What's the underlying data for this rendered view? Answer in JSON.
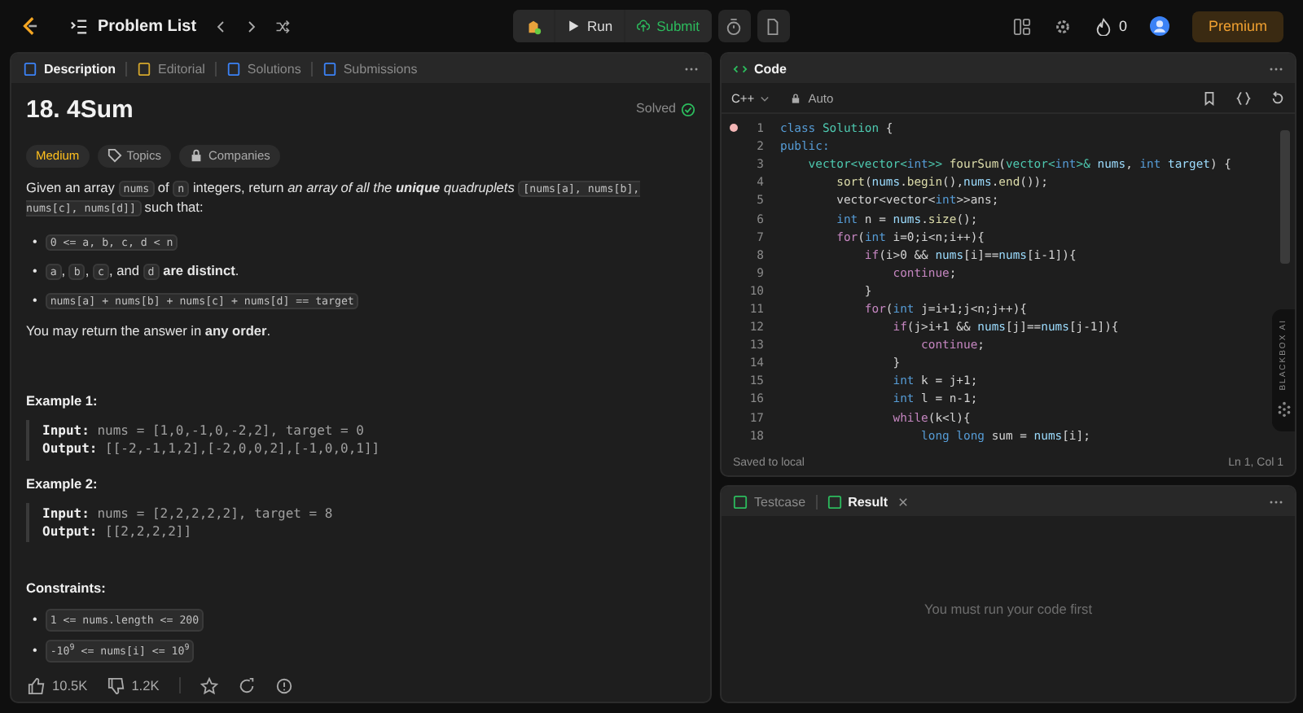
{
  "topbar": {
    "title": "Problem List",
    "run": "Run",
    "submit": "Submit",
    "streak": "0",
    "premium": "Premium"
  },
  "left_tabs": [
    {
      "label": "Description",
      "selected": true
    },
    {
      "label": "Editorial",
      "selected": false
    },
    {
      "label": "Solutions",
      "selected": false
    },
    {
      "label": "Submissions",
      "selected": false
    }
  ],
  "problem": {
    "title": "18. 4Sum",
    "status": "Solved",
    "difficulty": "Medium",
    "tags": [
      "Topics",
      "Companies"
    ],
    "statement": [
      {
        "kind": "text",
        "text": "Given an array "
      },
      {
        "kind": "code",
        "text": "nums"
      },
      {
        "kind": "text",
        "text": " of "
      },
      {
        "kind": "code",
        "text": "n"
      },
      {
        "kind": "text",
        "text": " integers, return "
      },
      {
        "kind": "italic",
        "text": "an array of all the "
      },
      {
        "kind": "bold_italic",
        "text": "unique"
      },
      {
        "kind": "italic",
        "text": " quadruplets "
      },
      {
        "kind": "code",
        "text": "[nums[a], nums[b], nums[c], nums[d]]"
      },
      {
        "kind": "text",
        "text": " such that:"
      }
    ],
    "conditions": [
      {
        "bullet": "•",
        "parts": [
          {
            "kind": "code",
            "text": "0 <= a, b, c, d < n"
          }
        ]
      },
      {
        "bullet": "•",
        "parts": [
          {
            "kind": "code",
            "text": "a"
          },
          {
            "kind": "text",
            "text": ", "
          },
          {
            "kind": "code",
            "text": "b"
          },
          {
            "kind": "text",
            "text": ", "
          },
          {
            "kind": "code",
            "text": "c"
          },
          {
            "kind": "text",
            "text": ", and "
          },
          {
            "kind": "code",
            "text": "d"
          },
          {
            "kind": "text",
            "text": " **are distinct**."
          }
        ]
      },
      {
        "bullet": "•",
        "parts": [
          {
            "kind": "code",
            "text": "nums[a] + nums[b] + nums[c] + nums[d] == target"
          }
        ]
      }
    ],
    "note": "You may return the answer in **any order**.",
    "examples": [
      {
        "title": "Example 1:",
        "input_label": "Input:",
        "input": "nums = [1,0,-1,0,-2,2], target = 0",
        "output_label": "Output:",
        "output": "[[-2,-1,1,2],[-2,0,0,2],[-1,0,0,1]]"
      },
      {
        "title": "Example 2:",
        "input_label": "Input:",
        "input": "nums = [2,2,2,2,2], target = 8",
        "output_label": "Output:",
        "output": "[[2,2,2,2]]"
      }
    ],
    "constraints_title": "Constraints:",
    "constraints": [
      {
        "bullet": "•",
        "text": "1 <= nums.length <= 200"
      },
      {
        "bullet": "•",
        "text": "-10$^{9}$ <= nums[i] <= 10$^{9}$"
      }
    ],
    "likes": "10.5K",
    "dislikes": "1.2K"
  },
  "code_panel": {
    "tab": "Code",
    "language": "C++",
    "mode": "Auto",
    "status": "Saved to local",
    "cursor": "Ln 1, Col 1",
    "assistant": "BLACKBOX AI",
    "lines": [
      {
        "num": "1",
        "breakpoint": true,
        "tokens": [
          {
            "kind": "kw",
            "text": "class"
          },
          {
            "kind": "ty",
            "text": " Solution"
          },
          {
            "kind": "p",
            "text": " {"
          }
        ]
      },
      {
        "num": "2",
        "breakpoint": false,
        "tokens": [
          {
            "kind": "kw",
            "text": "public:"
          }
        ]
      },
      {
        "num": "3",
        "breakpoint": false,
        "tokens": [
          {
            "kind": "ty",
            "text": "    vector<vector<"
          },
          {
            "kind": "kw",
            "text": "int"
          },
          {
            "kind": "ty",
            "text": ">> "
          },
          {
            "kind": "fn",
            "text": "fourSum"
          },
          {
            "kind": "p",
            "text": "("
          },
          {
            "kind": "ty",
            "text": "vector<"
          },
          {
            "kind": "kw",
            "text": "int"
          },
          {
            "kind": "ty",
            "text": ">&"
          },
          {
            "kind": "v",
            "text": " nums"
          },
          {
            "kind": "p",
            "text": ", "
          },
          {
            "kind": "kw",
            "text": "int"
          },
          {
            "kind": "v",
            "text": " target"
          },
          {
            "kind": "p",
            "text": ") {"
          }
        ]
      },
      {
        "num": "4",
        "breakpoint": false,
        "tokens": [
          {
            "kind": "fn",
            "text": "        sort"
          },
          {
            "kind": "p",
            "text": "("
          },
          {
            "kind": "v",
            "text": "nums"
          },
          {
            "kind": "p",
            "text": "."
          },
          {
            "kind": "fn",
            "text": "begin"
          },
          {
            "kind": "p",
            "text": "(),"
          },
          {
            "kind": "v",
            "text": "nums"
          },
          {
            "kind": "p",
            "text": "."
          },
          {
            "kind": "fn",
            "text": "end"
          },
          {
            "kind": "p",
            "text": "());"
          }
        ]
      },
      {
        "num": "5",
        "breakpoint": false,
        "tokens": [
          {
            "kind": "p",
            "text": "        vector<vector<"
          },
          {
            "kind": "kw",
            "text": "int"
          },
          {
            "kind": "p",
            "text": ">>ans;"
          }
        ]
      },
      {
        "num": "6",
        "breakpoint": false,
        "tokens": [
          {
            "kind": "kw",
            "text": "        int"
          },
          {
            "kind": "p",
            "text": " n = "
          },
          {
            "kind": "v",
            "text": "nums"
          },
          {
            "kind": "p",
            "text": "."
          },
          {
            "kind": "fn",
            "text": "size"
          },
          {
            "kind": "p",
            "text": "();"
          }
        ]
      },
      {
        "num": "7",
        "breakpoint": false,
        "tokens": [
          {
            "kind": "ctl",
            "text": "        for"
          },
          {
            "kind": "p",
            "text": "("
          },
          {
            "kind": "kw",
            "text": "int"
          },
          {
            "kind": "p",
            "text": " i=0;i<n;i++){"
          }
        ]
      },
      {
        "num": "8",
        "breakpoint": false,
        "tokens": [
          {
            "kind": "ctl",
            "text": "            if"
          },
          {
            "kind": "p",
            "text": "(i>0 && "
          },
          {
            "kind": "v",
            "text": "nums"
          },
          {
            "kind": "p",
            "text": "[i]=="
          },
          {
            "kind": "v",
            "text": "nums"
          },
          {
            "kind": "p",
            "text": "[i-1]){"
          }
        ]
      },
      {
        "num": "9",
        "breakpoint": false,
        "tokens": [
          {
            "kind": "ctl",
            "text": "                continue"
          },
          {
            "kind": "p",
            "text": ";"
          }
        ]
      },
      {
        "num": "10",
        "breakpoint": false,
        "tokens": [
          {
            "kind": "p",
            "text": "            }"
          }
        ]
      },
      {
        "num": "11",
        "breakpoint": false,
        "tokens": [
          {
            "kind": "ctl",
            "text": "            for"
          },
          {
            "kind": "p",
            "text": "("
          },
          {
            "kind": "kw",
            "text": "int"
          },
          {
            "kind": "p",
            "text": " j=i+1;j<n;j++){"
          }
        ]
      },
      {
        "num": "12",
        "breakpoint": false,
        "tokens": [
          {
            "kind": "ctl",
            "text": "                if"
          },
          {
            "kind": "p",
            "text": "(j>i+1 && "
          },
          {
            "kind": "v",
            "text": "nums"
          },
          {
            "kind": "p",
            "text": "[j]=="
          },
          {
            "kind": "v",
            "text": "nums"
          },
          {
            "kind": "p",
            "text": "[j-1]){"
          }
        ]
      },
      {
        "num": "13",
        "breakpoint": false,
        "tokens": [
          {
            "kind": "ctl",
            "text": "                    continue"
          },
          {
            "kind": "p",
            "text": ";"
          }
        ]
      },
      {
        "num": "14",
        "breakpoint": false,
        "tokens": [
          {
            "kind": "p",
            "text": "                }"
          }
        ]
      },
      {
        "num": "15",
        "breakpoint": false,
        "tokens": [
          {
            "kind": "kw",
            "text": "                int"
          },
          {
            "kind": "p",
            "text": " k = j+1;"
          }
        ]
      },
      {
        "num": "16",
        "breakpoint": false,
        "tokens": [
          {
            "kind": "kw",
            "text": "                int"
          },
          {
            "kind": "p",
            "text": " l = n-1;"
          }
        ]
      },
      {
        "num": "17",
        "breakpoint": false,
        "tokens": [
          {
            "kind": "ctl",
            "text": "                while"
          },
          {
            "kind": "p",
            "text": "(k<l){"
          }
        ]
      },
      {
        "num": "18",
        "breakpoint": false,
        "tokens": [
          {
            "kind": "kw",
            "text": "                    long long"
          },
          {
            "kind": "p",
            "text": " sum = "
          },
          {
            "kind": "v",
            "text": "nums"
          },
          {
            "kind": "p",
            "text": "[i];"
          }
        ]
      }
    ]
  },
  "result_tabs": [
    {
      "label": "Testcase",
      "selected": false,
      "closable": false
    },
    {
      "label": "Result",
      "selected": true,
      "closable": true
    }
  ],
  "result_message": "You must run your code first"
}
